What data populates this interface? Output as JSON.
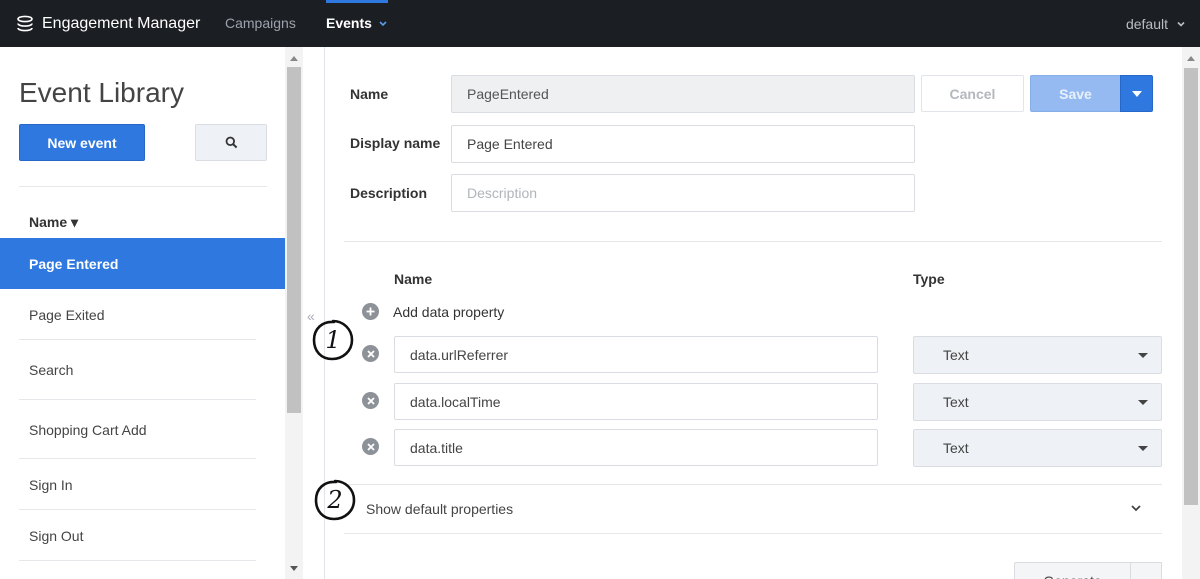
{
  "app": {
    "title": "Engagement Manager",
    "nav": [
      "Campaigns",
      "Events"
    ],
    "active_nav": "Events",
    "environment": "default",
    "accent": "#2f78e0"
  },
  "sidebar": {
    "title": "Event Library",
    "new_event_label": "New event",
    "sort_column": "Name ▾",
    "events": [
      "Page Entered",
      "Page Exited",
      "Search",
      "Shopping Cart Add",
      "Sign In",
      "Sign Out"
    ],
    "selected_event": "Page Entered"
  },
  "form": {
    "name_label": "Name",
    "name_value": "PageEntered",
    "display_name_label": "Display name",
    "display_name_value": "Page Entered",
    "description_label": "Description",
    "description_placeholder": "Description",
    "cancel_label": "Cancel",
    "save_label": "Save"
  },
  "properties": {
    "name_header": "Name",
    "type_header": "Type",
    "add_label": "Add data property",
    "items": [
      {
        "name": "data.urlReferrer",
        "type": "Text"
      },
      {
        "name": "data.localTime",
        "type": "Text"
      },
      {
        "name": "data.title",
        "type": "Text"
      }
    ],
    "show_default_label": "Show default properties"
  },
  "footer": {
    "generate_label": "Generate"
  },
  "annotations": {
    "callout_1": "1",
    "callout_2": "2"
  }
}
